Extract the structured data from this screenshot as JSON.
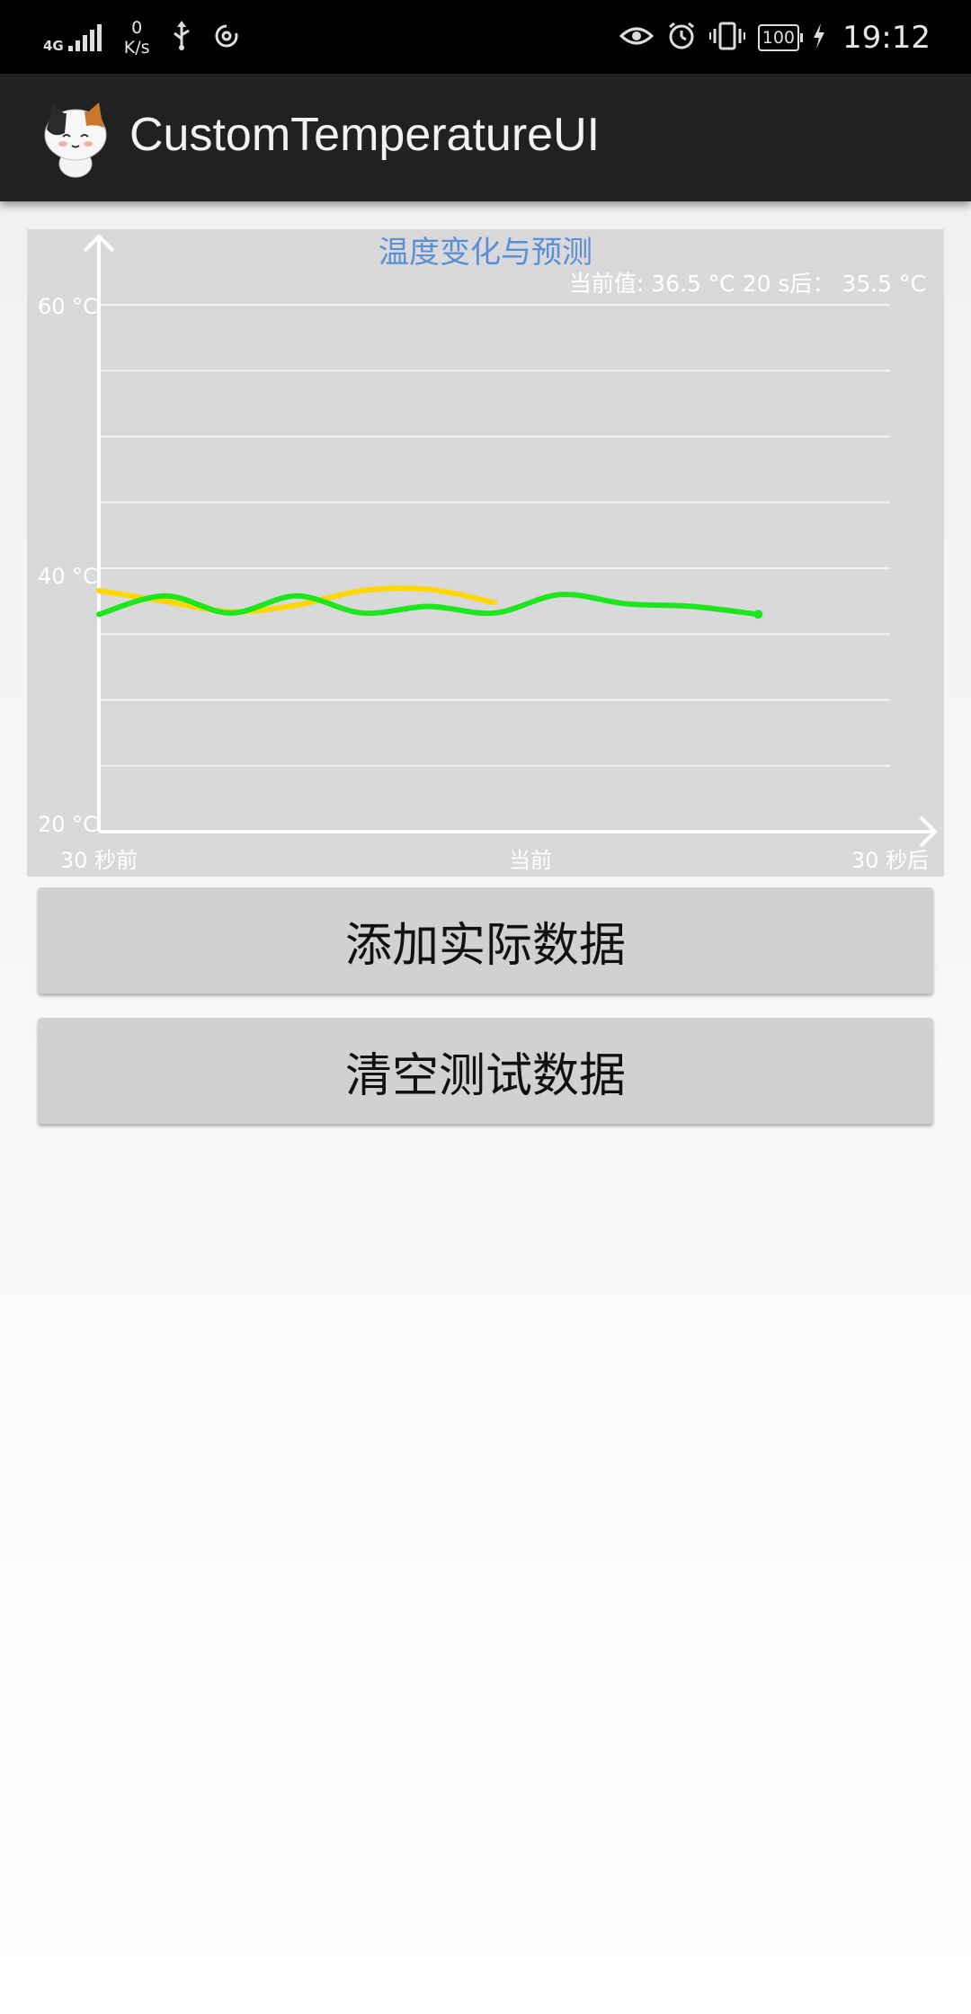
{
  "status_bar": {
    "network_type": "4G",
    "net_speed_value": "0",
    "net_speed_unit": "K/s",
    "battery": "100",
    "time": "19:12",
    "icons": [
      "signal-icon",
      "usb-icon",
      "sync-icon",
      "eye-icon",
      "alarm-icon",
      "vibrate-icon",
      "battery-icon",
      "charging-icon"
    ]
  },
  "app_bar": {
    "title": "CustomTemperatureUI",
    "icon": "cat-app-icon"
  },
  "chart": {
    "current_readout": "当前值: 36.5 °C 20 s后： 35.5 °C"
  },
  "chart_data": {
    "type": "line",
    "title": "温度变化与预测",
    "y_ticks": [
      "60 °C",
      "40 °C",
      "20 °C"
    ],
    "ylim": [
      20,
      60
    ],
    "x_tick_labels": [
      "30 秒前",
      "当前",
      "30 秒后"
    ],
    "xlim": [
      -30,
      30
    ],
    "grid": true,
    "colors": {
      "actual": "#ffd700",
      "prediction": "#1ee61e",
      "title": "#5b8fd6",
      "axis": "#ffffff"
    },
    "series": [
      {
        "color": "#ffd700",
        "x": [
          -30,
          -25,
          -20,
          -15,
          -10,
          -5,
          0
        ],
        "y": [
          38.3,
          37.5,
          36.7,
          37.2,
          38.3,
          38.4,
          37.4
        ]
      },
      {
        "color": "#1ee61e",
        "x": [
          -30,
          -25,
          -20,
          -15,
          -10,
          -5,
          0,
          5,
          10,
          15,
          20
        ],
        "y": [
          36.5,
          37.9,
          36.6,
          37.9,
          36.6,
          37.1,
          36.6,
          38.0,
          37.3,
          37.1,
          36.5
        ]
      }
    ]
  },
  "buttons": {
    "add_label": "添加实际数据",
    "clear_label": "清空测试数据"
  }
}
